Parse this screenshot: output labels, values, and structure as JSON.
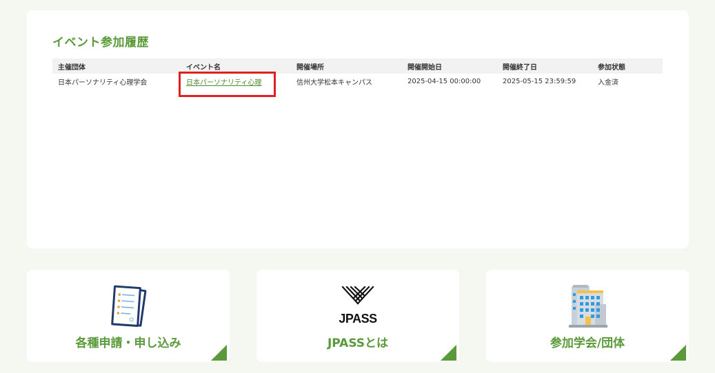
{
  "history": {
    "title": "イベント参加履歴",
    "columns": [
      "主催団体",
      "イベント名",
      "開催場所",
      "開催開始日",
      "開催終了日",
      "参加状態"
    ],
    "rows": [
      {
        "organizer": "日本パーソナリティ心理学会",
        "event_name": "日本パーソナリティ心理",
        "venue": "信州大学松本キャンパス",
        "start": "2025-04-15 00:00:00",
        "end": "2025-05-15 23:59:59",
        "status": "入金済"
      }
    ]
  },
  "cards": [
    {
      "label": "各種申請・申し込み",
      "icon": "document-checklist-icon"
    },
    {
      "label": "JPASSとは",
      "icon": "jpass-logo-icon",
      "logo_text": "JPASS"
    },
    {
      "label": "参加学会/団体",
      "icon": "building-icon"
    }
  ],
  "colors": {
    "accent_green": "#5a9a3a",
    "link_green": "#4e8c30",
    "highlight_red": "#e02020",
    "background": "#f4f8f0"
  }
}
